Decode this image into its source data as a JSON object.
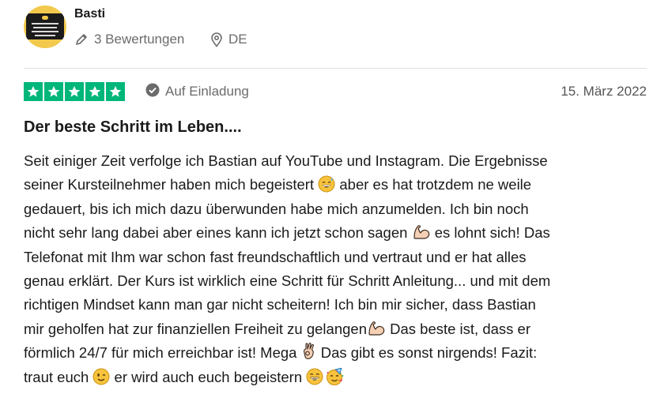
{
  "reviewer": {
    "name": "Basti",
    "reviews_count": "3 Bewertungen",
    "country": "DE"
  },
  "review": {
    "rating": 5,
    "rating_max": 5,
    "verification": "Auf Einladung",
    "date": "15. März 2022",
    "title": "Der beste Schritt im Leben....",
    "lines": [
      [
        "Seit einiger Zeit verfolge ich Bastian auf YouTube und Instagram. Die Ergebnisse"
      ],
      [
        "seiner Kursteilnehmer haben mich begeistert ",
        " aber es hat trotzdem ne weile"
      ],
      [
        "gedauert, bis ich mich dazu überwunden habe mich anzumelden. Ich bin noch"
      ],
      [
        "nicht sehr lang dabei aber eines kann ich jetzt schon sagen ",
        " es lohnt sich! Das"
      ],
      [
        "Telefonat mit Ihm war schon fast freundschaftlich und vertraut und er hat alles"
      ],
      [
        "genau erklärt. Der Kurs ist wirklich eine Schritt für Schritt Anleitung... und mit dem"
      ],
      [
        "richtigen Mindset kann man gar nicht scheitern! Ich bin mir sicher, dass Bastian"
      ],
      [
        "mir geholfen hat zur finanziellen Freiheit zu gelangen",
        " Das beste ist, dass er"
      ],
      [
        "förmlich 24/7 für mich erreichbar ist! Mega ",
        " Das gibt es sonst nirgends! Fazit:"
      ],
      [
        "traut euch ",
        " er wird auch euch begeistern "
      ]
    ]
  },
  "colors": {
    "star_green": "#00b67a",
    "meta_gray": "#6b6b6b",
    "emoji_yellow": "#f7c33c"
  },
  "icons": {
    "reviews": "pencil-icon",
    "country": "location-pin-icon",
    "verification": "check-badge-icon"
  }
}
